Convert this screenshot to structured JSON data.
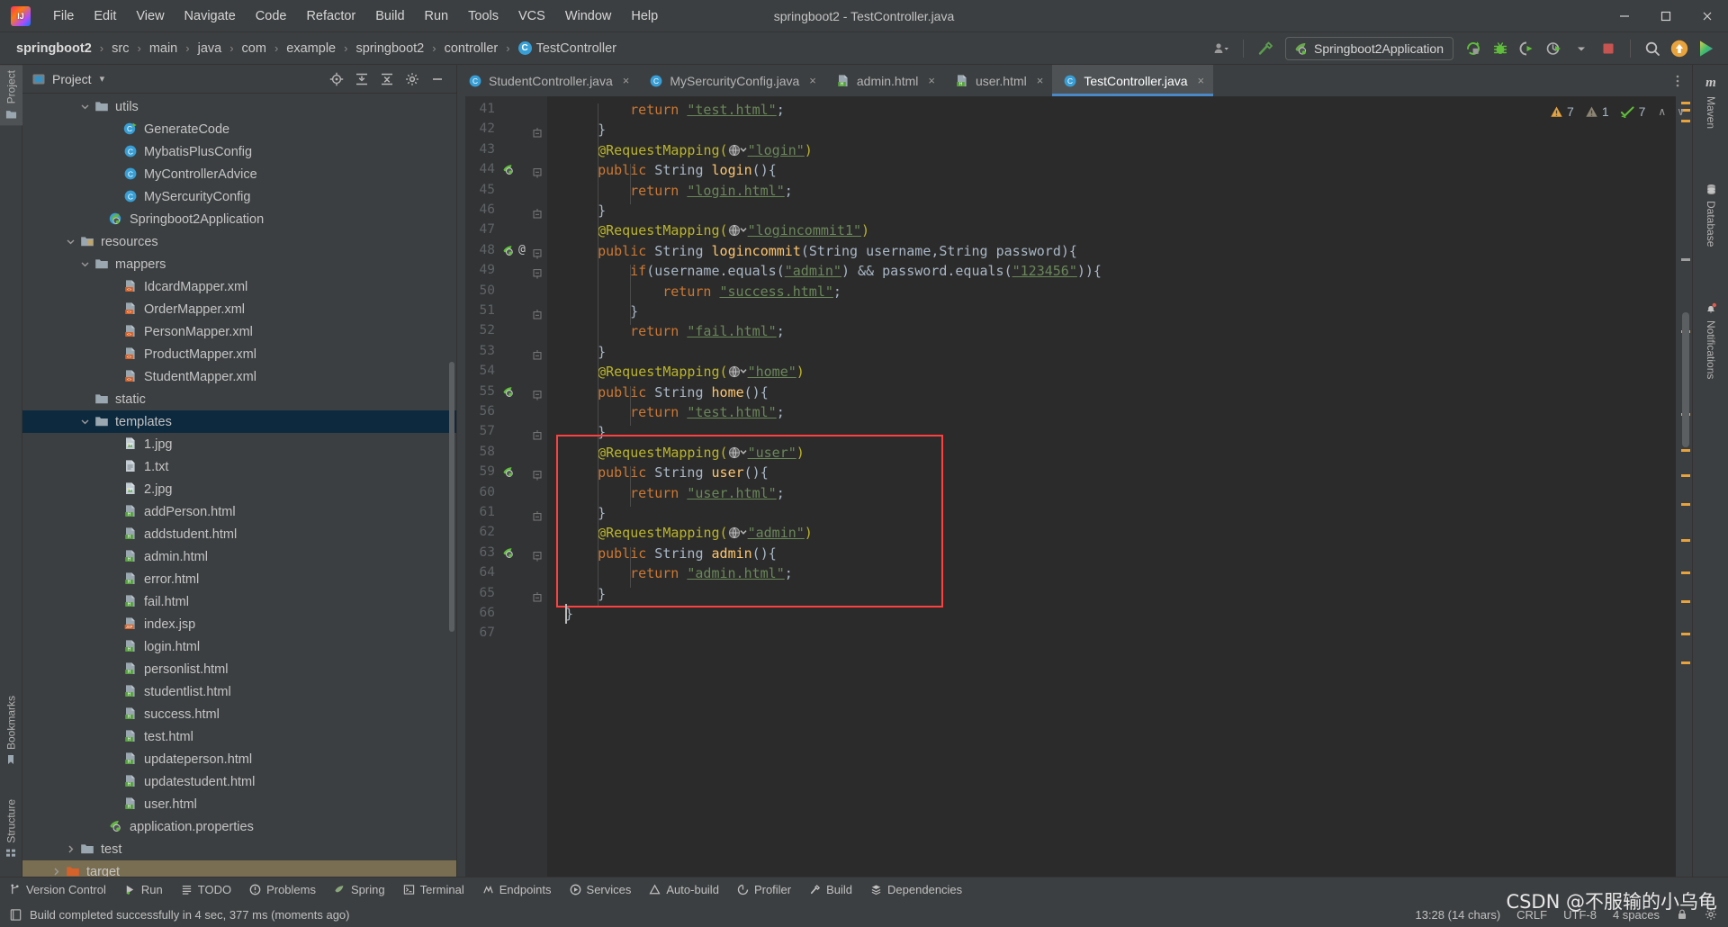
{
  "window": {
    "title": "springboot2 - TestController.java",
    "minimize_label": "—",
    "maximize_label": "❐",
    "close_label": "✕"
  },
  "menu": {
    "items": [
      {
        "label": "File"
      },
      {
        "label": "Edit"
      },
      {
        "label": "View"
      },
      {
        "label": "Navigate"
      },
      {
        "label": "Code"
      },
      {
        "label": "Refactor"
      },
      {
        "label": "Build"
      },
      {
        "label": "Run"
      },
      {
        "label": "Tools"
      },
      {
        "label": "VCS"
      },
      {
        "label": "Window"
      },
      {
        "label": "Help"
      }
    ]
  },
  "breadcrumb": {
    "items": [
      "springboot2",
      "src",
      "main",
      "java",
      "com",
      "example",
      "springboot2",
      "controller"
    ],
    "last": "TestController",
    "last_icon": "C",
    "separator": "›"
  },
  "toolbar": {
    "run_config": "Springboot2Application",
    "icons": [
      "user-group-icon",
      "hammer-build-icon",
      "run-icon",
      "rerun-icon",
      "debug-icon",
      "coverage-icon",
      "profile-icon",
      "stop-icon",
      "search-everywhere-icon",
      "update-project-icon",
      "ide-plugin-icon"
    ]
  },
  "left_strip": {
    "top": [
      {
        "label": "Project",
        "icon": "project-folder-icon",
        "active": true
      }
    ],
    "bottom": [
      {
        "label": "Bookmarks",
        "icon": "bookmark-icon"
      },
      {
        "label": "Structure",
        "icon": "structure-icon"
      }
    ]
  },
  "right_strip": {
    "items": [
      {
        "label": "Maven",
        "icon": "maven-m-icon"
      },
      {
        "label": "Database",
        "icon": "database-icon"
      },
      {
        "label": "Notifications",
        "icon": "bell-icon"
      }
    ]
  },
  "project_panel": {
    "title": "Project",
    "dropdown_glyph": "▾",
    "tools": [
      "locate-icon",
      "expand-all-icon",
      "collapse-all-icon",
      "settings-gear-icon",
      "hide-icon"
    ],
    "tree": [
      {
        "label": "utils",
        "indent": 4,
        "chev": "v",
        "icon": "folder",
        "state": ""
      },
      {
        "label": "GenerateCode",
        "indent": 6,
        "chev": "",
        "icon": "class-run",
        "state": ""
      },
      {
        "label": "MybatisPlusConfig",
        "indent": 6,
        "chev": "",
        "icon": "class",
        "state": ""
      },
      {
        "label": "MyControllerAdvice",
        "indent": 6,
        "chev": "",
        "icon": "class",
        "state": ""
      },
      {
        "label": "MySercurityConfig",
        "indent": 6,
        "chev": "",
        "icon": "class",
        "state": ""
      },
      {
        "label": "Springboot2Application",
        "indent": 5,
        "chev": "",
        "icon": "spring-class",
        "state": ""
      },
      {
        "label": "resources",
        "indent": 3,
        "chev": "v",
        "icon": "folder-res",
        "state": ""
      },
      {
        "label": "mappers",
        "indent": 4,
        "chev": "v",
        "icon": "folder",
        "state": ""
      },
      {
        "label": "IdcardMapper.xml",
        "indent": 6,
        "chev": "",
        "icon": "xml",
        "state": ""
      },
      {
        "label": "OrderMapper.xml",
        "indent": 6,
        "chev": "",
        "icon": "xml",
        "state": ""
      },
      {
        "label": "PersonMapper.xml",
        "indent": 6,
        "chev": "",
        "icon": "xml",
        "state": ""
      },
      {
        "label": "ProductMapper.xml",
        "indent": 6,
        "chev": "",
        "icon": "xml",
        "state": ""
      },
      {
        "label": "StudentMapper.xml",
        "indent": 6,
        "chev": "",
        "icon": "xml",
        "state": ""
      },
      {
        "label": "static",
        "indent": 4,
        "chev": "",
        "icon": "folder",
        "state": ""
      },
      {
        "label": "templates",
        "indent": 4,
        "chev": "v",
        "icon": "folder",
        "state": "sel"
      },
      {
        "label": "1.jpg",
        "indent": 6,
        "chev": "",
        "icon": "image",
        "state": ""
      },
      {
        "label": "1.txt",
        "indent": 6,
        "chev": "",
        "icon": "text",
        "state": ""
      },
      {
        "label": "2.jpg",
        "indent": 6,
        "chev": "",
        "icon": "image",
        "state": ""
      },
      {
        "label": "addPerson.html",
        "indent": 6,
        "chev": "",
        "icon": "html",
        "state": ""
      },
      {
        "label": "addstudent.html",
        "indent": 6,
        "chev": "",
        "icon": "html",
        "state": ""
      },
      {
        "label": "admin.html",
        "indent": 6,
        "chev": "",
        "icon": "html",
        "state": ""
      },
      {
        "label": "error.html",
        "indent": 6,
        "chev": "",
        "icon": "html",
        "state": ""
      },
      {
        "label": "fail.html",
        "indent": 6,
        "chev": "",
        "icon": "html",
        "state": ""
      },
      {
        "label": "index.jsp",
        "indent": 6,
        "chev": "",
        "icon": "jsp",
        "state": ""
      },
      {
        "label": "login.html",
        "indent": 6,
        "chev": "",
        "icon": "html",
        "state": ""
      },
      {
        "label": "personlist.html",
        "indent": 6,
        "chev": "",
        "icon": "html",
        "state": ""
      },
      {
        "label": "studentlist.html",
        "indent": 6,
        "chev": "",
        "icon": "html",
        "state": ""
      },
      {
        "label": "success.html",
        "indent": 6,
        "chev": "",
        "icon": "html",
        "state": ""
      },
      {
        "label": "test.html",
        "indent": 6,
        "chev": "",
        "icon": "html",
        "state": ""
      },
      {
        "label": "updateperson.html",
        "indent": 6,
        "chev": "",
        "icon": "html",
        "state": ""
      },
      {
        "label": "updatestudent.html",
        "indent": 6,
        "chev": "",
        "icon": "html",
        "state": ""
      },
      {
        "label": "user.html",
        "indent": 6,
        "chev": "",
        "icon": "html",
        "state": ""
      },
      {
        "label": "application.properties",
        "indent": 5,
        "chev": "",
        "icon": "spring-prop",
        "state": ""
      },
      {
        "label": "test",
        "indent": 3,
        "chev": ">",
        "icon": "folder",
        "state": ""
      },
      {
        "label": "target",
        "indent": 2,
        "chev": ">",
        "icon": "folder-orange",
        "state": "sel2"
      }
    ]
  },
  "editor": {
    "tabs": [
      {
        "label": "StudentController.java",
        "icon": "java-class-icon",
        "active": false
      },
      {
        "label": "MySercurityConfig.java",
        "icon": "java-class-icon",
        "active": false
      },
      {
        "label": "admin.html",
        "icon": "html-file-icon",
        "active": false
      },
      {
        "label": "user.html",
        "icon": "html-file-icon",
        "active": false
      },
      {
        "label": "TestController.java",
        "icon": "java-class-icon",
        "active": true
      }
    ],
    "tab_close_glyph": "×",
    "inspections": {
      "warnings": "7",
      "weak_warnings": "1",
      "typos": "7",
      "up_glyph": "∧",
      "down_glyph": "∨"
    },
    "first_line_number": 41,
    "lines": [
      {
        "n": 41,
        "indent": 8,
        "gutter": "",
        "fold": "",
        "tokens": [
          [
            "kw",
            "return "
          ],
          [
            "str",
            "\"test.html\""
          ],
          [
            "pln",
            ";"
          ]
        ]
      },
      {
        "n": 42,
        "indent": 4,
        "gutter": "",
        "fold": "end",
        "tokens": [
          [
            "pln",
            "}"
          ]
        ]
      },
      {
        "n": 43,
        "indent": 4,
        "gutter": "",
        "fold": "",
        "tokens": [
          [
            "ann",
            "@RequestMapping("
          ],
          [
            "globe",
            ""
          ],
          [
            "str",
            "\"login\""
          ],
          [
            "ann",
            ")"
          ]
        ]
      },
      {
        "n": 44,
        "indent": 4,
        "gutter": "spring",
        "fold": "start",
        "tokens": [
          [
            "kw",
            "public "
          ],
          [
            "typ",
            "String "
          ],
          [
            "mth",
            "login"
          ],
          [
            "pln",
            "(){"
          ]
        ]
      },
      {
        "n": 45,
        "indent": 8,
        "gutter": "",
        "fold": "",
        "tokens": [
          [
            "kw",
            "return "
          ],
          [
            "str",
            "\"login.html\""
          ],
          [
            "pln",
            ";"
          ]
        ]
      },
      {
        "n": 46,
        "indent": 4,
        "gutter": "",
        "fold": "end",
        "tokens": [
          [
            "pln",
            "}"
          ]
        ]
      },
      {
        "n": 47,
        "indent": 4,
        "gutter": "",
        "fold": "",
        "tokens": [
          [
            "ann",
            "@RequestMapping("
          ],
          [
            "globe",
            ""
          ],
          [
            "str",
            "\"logincommit1\""
          ],
          [
            "ann",
            ")"
          ]
        ]
      },
      {
        "n": 48,
        "indent": 4,
        "gutter": "spring-at",
        "fold": "start",
        "tokens": [
          [
            "kw",
            "public "
          ],
          [
            "typ",
            "String "
          ],
          [
            "mth",
            "logincommit"
          ],
          [
            "pln",
            "("
          ],
          [
            "typ",
            "String"
          ],
          [
            "pln",
            " username,"
          ],
          [
            "typ",
            "String"
          ],
          [
            "pln",
            " password){"
          ]
        ]
      },
      {
        "n": 49,
        "indent": 8,
        "gutter": "",
        "fold": "start",
        "tokens": [
          [
            "kw",
            "if"
          ],
          [
            "pln",
            "(username.equals("
          ],
          [
            "str",
            "\"admin\""
          ],
          [
            "pln",
            ") && password.equals("
          ],
          [
            "str",
            "\"123456\""
          ],
          [
            "pln",
            ")){"
          ]
        ]
      },
      {
        "n": 50,
        "indent": 12,
        "gutter": "",
        "fold": "",
        "tokens": [
          [
            "kw",
            "return "
          ],
          [
            "str",
            "\"success.html\""
          ],
          [
            "pln",
            ";"
          ]
        ]
      },
      {
        "n": 51,
        "indent": 8,
        "gutter": "",
        "fold": "end",
        "tokens": [
          [
            "pln",
            "}"
          ]
        ]
      },
      {
        "n": 52,
        "indent": 8,
        "gutter": "",
        "fold": "",
        "tokens": [
          [
            "kw",
            "return "
          ],
          [
            "str",
            "\"fail.html\""
          ],
          [
            "pln",
            ";"
          ]
        ]
      },
      {
        "n": 53,
        "indent": 4,
        "gutter": "",
        "fold": "end",
        "tokens": [
          [
            "pln",
            "}"
          ]
        ]
      },
      {
        "n": 54,
        "indent": 4,
        "gutter": "",
        "fold": "",
        "tokens": [
          [
            "ann",
            "@RequestMapping("
          ],
          [
            "globe",
            ""
          ],
          [
            "str",
            "\"home\""
          ],
          [
            "ann",
            ")"
          ]
        ]
      },
      {
        "n": 55,
        "indent": 4,
        "gutter": "spring",
        "fold": "start",
        "tokens": [
          [
            "kw",
            "public "
          ],
          [
            "typ",
            "String "
          ],
          [
            "mth",
            "home"
          ],
          [
            "pln",
            "(){"
          ]
        ]
      },
      {
        "n": 56,
        "indent": 8,
        "gutter": "",
        "fold": "",
        "tokens": [
          [
            "kw",
            "return "
          ],
          [
            "str",
            "\"test.html\""
          ],
          [
            "pln",
            ";"
          ]
        ]
      },
      {
        "n": 57,
        "indent": 4,
        "gutter": "",
        "fold": "end",
        "tokens": [
          [
            "pln",
            "}"
          ]
        ]
      },
      {
        "n": 58,
        "indent": 4,
        "gutter": "",
        "fold": "",
        "tokens": [
          [
            "ann",
            "@RequestMapping("
          ],
          [
            "globe",
            ""
          ],
          [
            "str",
            "\"user\""
          ],
          [
            "ann",
            ")"
          ]
        ]
      },
      {
        "n": 59,
        "indent": 4,
        "gutter": "spring",
        "fold": "start",
        "tokens": [
          [
            "kw",
            "public "
          ],
          [
            "typ",
            "String "
          ],
          [
            "mth",
            "user"
          ],
          [
            "pln",
            "(){"
          ]
        ]
      },
      {
        "n": 60,
        "indent": 8,
        "gutter": "",
        "fold": "",
        "tokens": [
          [
            "kw",
            "return "
          ],
          [
            "str",
            "\"user.html\""
          ],
          [
            "pln",
            ";"
          ]
        ]
      },
      {
        "n": 61,
        "indent": 4,
        "gutter": "",
        "fold": "end",
        "tokens": [
          [
            "pln",
            "}"
          ]
        ]
      },
      {
        "n": 62,
        "indent": 4,
        "gutter": "",
        "fold": "",
        "tokens": [
          [
            "ann",
            "@RequestMapping("
          ],
          [
            "globe",
            ""
          ],
          [
            "str",
            "\"admin\""
          ],
          [
            "ann",
            ")"
          ]
        ]
      },
      {
        "n": 63,
        "indent": 4,
        "gutter": "spring",
        "fold": "start",
        "tokens": [
          [
            "kw",
            "public "
          ],
          [
            "typ",
            "String "
          ],
          [
            "mth",
            "admin"
          ],
          [
            "pln",
            "(){"
          ]
        ]
      },
      {
        "n": 64,
        "indent": 8,
        "gutter": "",
        "fold": "",
        "tokens": [
          [
            "kw",
            "return "
          ],
          [
            "str",
            "\"admin.html\""
          ],
          [
            "pln",
            ";"
          ]
        ]
      },
      {
        "n": 65,
        "indent": 4,
        "gutter": "",
        "fold": "end",
        "tokens": [
          [
            "pln",
            "}"
          ]
        ]
      },
      {
        "n": 66,
        "indent": 0,
        "gutter": "",
        "fold": "",
        "tokens": [
          [
            "pln",
            "}"
          ]
        ]
      },
      {
        "n": 67,
        "indent": 0,
        "gutter": "",
        "fold": "",
        "tokens": []
      }
    ],
    "annotation_box": {
      "label": "red-highlight-box",
      "color": "#ff4040",
      "from_line": 57,
      "to_line": 66
    }
  },
  "tool_windows": [
    {
      "label": "Version Control",
      "icon": "branch-icon"
    },
    {
      "label": "Run",
      "icon": "run-triangle-icon"
    },
    {
      "label": "TODO",
      "icon": "todo-list-icon"
    },
    {
      "label": "Problems",
      "icon": "problems-icon"
    },
    {
      "label": "Spring",
      "icon": "spring-leaf-icon"
    },
    {
      "label": "Terminal",
      "icon": "terminal-icon"
    },
    {
      "label": "Endpoints",
      "icon": "endpoints-icon"
    },
    {
      "label": "Services",
      "icon": "services-icon"
    },
    {
      "label": "Auto-build",
      "icon": "autobuild-icon"
    },
    {
      "label": "Profiler",
      "icon": "profiler-icon"
    },
    {
      "label": "Build",
      "icon": "hammer-icon"
    },
    {
      "label": "Dependencies",
      "icon": "dependencies-icon"
    }
  ],
  "status": {
    "message": "Build completed successfully in 4 sec, 377 ms (moments ago)",
    "position": "13:28 (14 chars)",
    "line_sep": "CRLF",
    "encoding": "UTF-8",
    "indent": "4 spaces",
    "lock_icon": "read-only-lock-icon",
    "gear_icon": "settings-gear-icon"
  },
  "watermark": "CSDN @不服输的小乌龟",
  "colors": {
    "accent_blue": "#4a88c7",
    "selection": "#0d293e",
    "editor_bg": "#2b2b2b",
    "panel_bg": "#3c3f41",
    "gutter_bg": "#313335",
    "highlight_red": "#ff4040",
    "string_green": "#6a8759",
    "annotation_yellow": "#bbb529",
    "keyword_orange": "#cc7832",
    "method_gold": "#ffc66d"
  }
}
